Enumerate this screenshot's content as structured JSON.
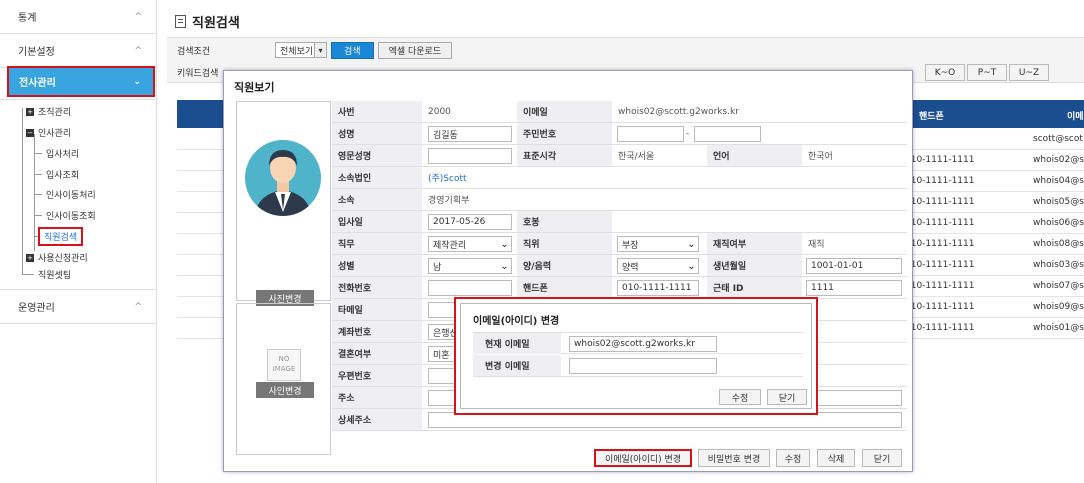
{
  "sidebar": {
    "stats": "통계",
    "basic": "기본설정",
    "hr": "전사관리",
    "tree": {
      "org": "조직관리",
      "hr_mgmt": "인사관리",
      "hire": "입사처리",
      "hire_lookup": "입사조회",
      "transfer": "인사이동처리",
      "transfer_lookup": "인사이동조회",
      "emp_search": "직원검색",
      "usage": "사용신청관리",
      "emp_settings": "직원셋팅"
    },
    "ops": "운영관리"
  },
  "page": {
    "title": "직원검색",
    "search_cond_label": "검색조건",
    "search_select": "전체보기",
    "search_btn": "검색",
    "excel_btn": "엑셀 다운로드",
    "keyword_label": "키워드검색",
    "keyword_buttons": [
      "K~O",
      "P~T",
      "U~Z"
    ]
  },
  "bg_table": {
    "headers": {
      "phone": "핸드폰",
      "email": "이메"
    },
    "rows": [
      {
        "phone": "",
        "email": "scott@scot"
      },
      {
        "phone": "010-1111-1111",
        "email": "whois02@sco"
      },
      {
        "phone": "010-1111-1111",
        "email": "whois04@sco"
      },
      {
        "phone": "010-1111-1111",
        "email": "whois05@sco"
      },
      {
        "phone": "010-1111-1111",
        "email": "whois06@sco"
      },
      {
        "phone": "010-1111-1111",
        "email": "whois08@sco"
      },
      {
        "phone": "010-1111-1111",
        "email": "whois03@sco"
      },
      {
        "phone": "010-1111-1111",
        "email": "whois07@sco"
      },
      {
        "phone": "010-1111-1111",
        "email": "whois09@sco"
      },
      {
        "phone": "010-1111-1111",
        "email": "whois01@sco"
      }
    ]
  },
  "modal": {
    "title": "직원보기",
    "photo_btn": "사진변경",
    "photo_btn2": "사인변경",
    "noimg": "NO IMAGE",
    "labels": {
      "emp_no": "사번",
      "email": "이메일",
      "name": "성명",
      "rrn": "주민번호",
      "eng_name": "영문성명",
      "timezone": "표준시각",
      "lang": "언어",
      "company": "소속법인",
      "dept": "소속",
      "join_date": "입사일",
      "title_no": "호봉",
      "duty": "직무",
      "position": "직위",
      "status": "재직여부",
      "gender": "성별",
      "calendar": "양/음력",
      "birthday": "생년월일",
      "tel": "전화번호",
      "mobile": "핸드폰",
      "attend_id": "근태 ID",
      "fax": "타메일",
      "account": "계좌번호",
      "marital": "결혼여부",
      "zipcode": "우편번호",
      "address": "주소",
      "address_detail": "상세주소"
    },
    "values": {
      "emp_no": "2000",
      "email": "whois02@scott.g2works.kr",
      "name": "김길동",
      "rrn_sep": "-",
      "timezone": "한국/서울",
      "lang": "한국어",
      "company": "(주)Scott",
      "dept": "경영기획부",
      "join_date": "2017-05-26",
      "duty": "제작관리",
      "position": "부장",
      "status": "재직",
      "gender": "남",
      "calendar": "양력",
      "birthday": "1001-01-01",
      "mobile": "010-1111-1111",
      "attend_id": "1111",
      "account": "은행선",
      "marital": "미혼"
    },
    "footer": {
      "change_email": "이메일(아이디) 변경",
      "change_pw": "비밀번호 변경",
      "edit": "수정",
      "delete": "삭제",
      "close": "닫기"
    }
  },
  "submodal": {
    "title": "이메일(아이디) 변경",
    "current_label": "현재 이메일",
    "current_value": "whois02@scott.g2works.kr",
    "new_label": "변경 이메일",
    "edit_btn": "수정",
    "close_btn": "닫기"
  }
}
